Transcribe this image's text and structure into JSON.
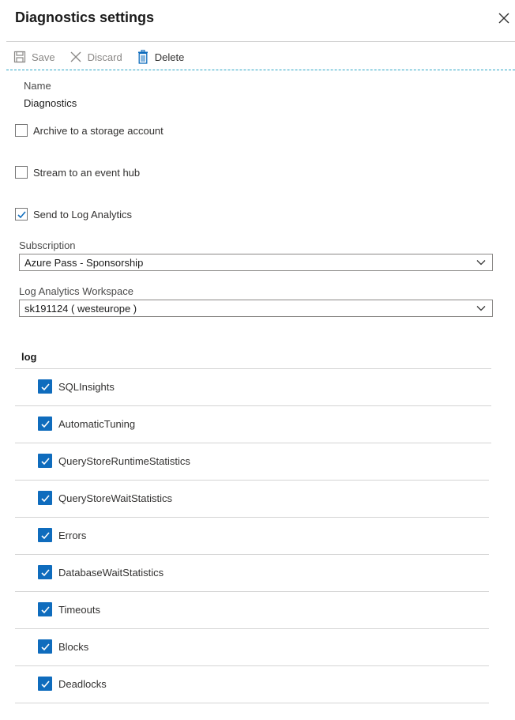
{
  "header": {
    "title": "Diagnostics settings",
    "close_icon": "close-icon"
  },
  "toolbar": {
    "save_label": "Save",
    "discard_label": "Discard",
    "delete_label": "Delete"
  },
  "name_field": {
    "label": "Name",
    "value": "Diagnostics"
  },
  "destinations": {
    "archive": {
      "label": "Archive to a storage account",
      "checked": false
    },
    "stream": {
      "label": "Stream to an event hub",
      "checked": false
    },
    "log_analytics": {
      "label": "Send to Log Analytics",
      "checked": true
    }
  },
  "subscription": {
    "label": "Subscription",
    "value": "Azure Pass - Sponsorship"
  },
  "workspace": {
    "label": "Log Analytics Workspace",
    "value": "sk191124 ( westeurope )"
  },
  "log_section": {
    "title": "log",
    "items": [
      {
        "label": "SQLInsights",
        "checked": true
      },
      {
        "label": "AutomaticTuning",
        "checked": true
      },
      {
        "label": "QueryStoreRuntimeStatistics",
        "checked": true
      },
      {
        "label": "QueryStoreWaitStatistics",
        "checked": true
      },
      {
        "label": "Errors",
        "checked": true
      },
      {
        "label": "DatabaseWaitStatistics",
        "checked": true
      },
      {
        "label": "Timeouts",
        "checked": true
      },
      {
        "label": "Blocks",
        "checked": true
      },
      {
        "label": "Deadlocks",
        "checked": true
      }
    ]
  },
  "colors": {
    "accent": "#0f6cbd",
    "dashed_divider": "#2aa5c6"
  }
}
